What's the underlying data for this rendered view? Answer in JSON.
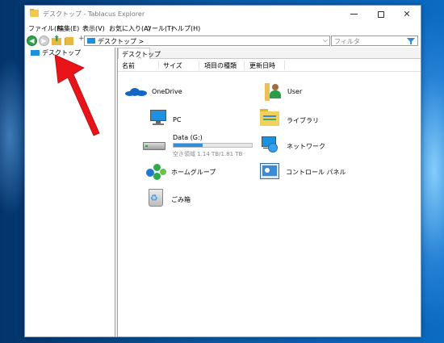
{
  "window": {
    "title": "デスクトップ - Tablacus Explorer",
    "icon": "folder-icon"
  },
  "menubar": {
    "items": [
      "ファイル(F)",
      "編集(E)",
      "表示(V)",
      "お気に入り(A)",
      "ツール(T)",
      "ヘルプ(H)"
    ]
  },
  "toolbar": {
    "address": "デスクトップ >",
    "filter_placeholder": "フィルタ",
    "plus": "+"
  },
  "tree": {
    "items": [
      {
        "label": "デスクトップ",
        "icon": "desktop-icon"
      }
    ]
  },
  "tabs": [
    {
      "label": "デスクトップ"
    }
  ],
  "columns": [
    "名前",
    "サイズ",
    "項目の種類",
    "更新日時"
  ],
  "items": [
    {
      "label": "OneDrive",
      "icon": "onedrive-icon"
    },
    {
      "label": "User",
      "icon": "user-folder-icon"
    },
    {
      "label": "PC",
      "icon": "pc-icon"
    },
    {
      "label": "ライブラリ",
      "icon": "library-icon"
    },
    {
      "label": "Data (G:)",
      "icon": "drive-icon",
      "capacity_info": "空き領域 1.14 TB/1.81 TB",
      "used_fraction": 0.37
    },
    {
      "label": "ネットワーク",
      "icon": "network-icon"
    },
    {
      "label": "ホームグループ",
      "icon": "homegroup-icon"
    },
    {
      "label": "コントロール パネル",
      "icon": "control-panel-icon"
    },
    {
      "label": "ごみ箱",
      "icon": "recycle-bin-icon"
    }
  ],
  "colors": {
    "annotation_arrow": "#e8141a",
    "accent": "#1e90e0"
  }
}
